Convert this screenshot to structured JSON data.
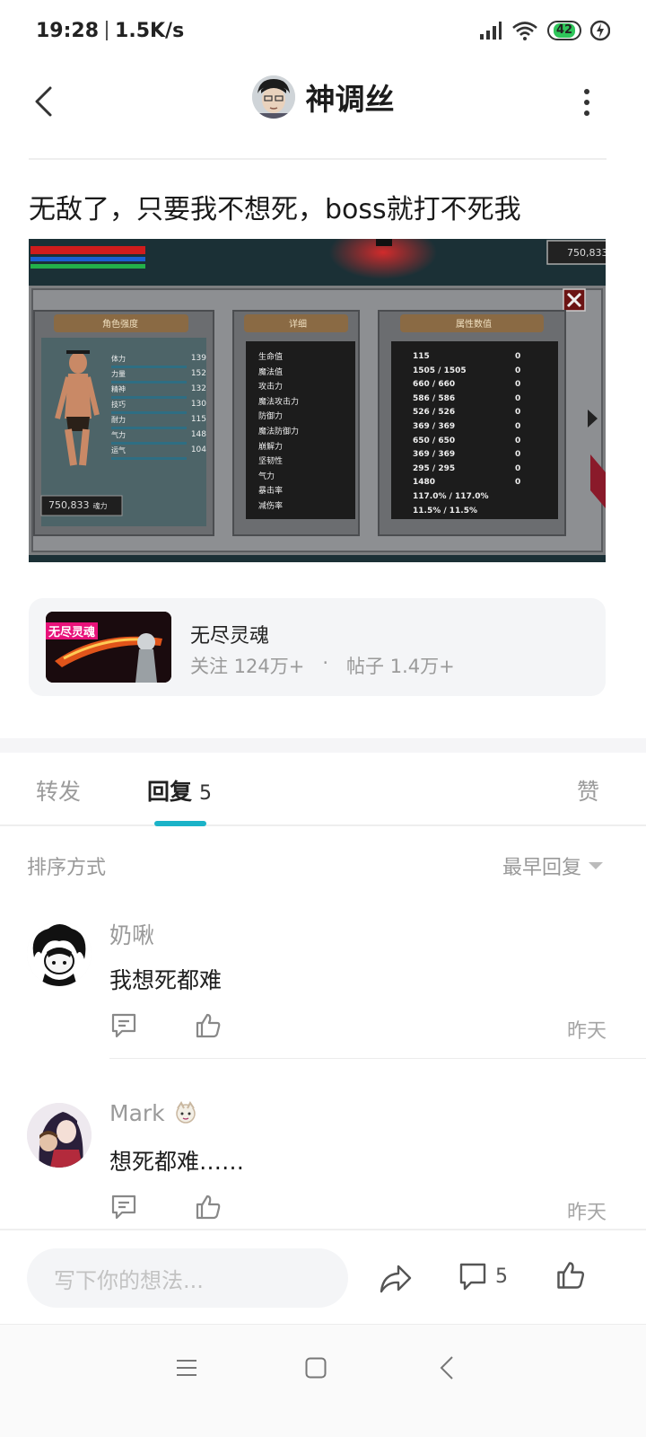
{
  "status_bar": {
    "time": "19:28",
    "net_speed": "1.5K/s",
    "battery": "42"
  },
  "header": {
    "author_name": "神调丝"
  },
  "post": {
    "title": "无敌了，只要我不想死，boss就打不死我",
    "image": {
      "currency_top": "750,833",
      "panel_character": "角色强度",
      "panel_detail": "详细",
      "panel_attributes": "属性数值",
      "char_stats": [
        {
          "label": "体力",
          "value": "139"
        },
        {
          "label": "力量",
          "value": "152"
        },
        {
          "label": "精神",
          "value": "132"
        },
        {
          "label": "技巧",
          "value": "130"
        },
        {
          "label": "耐力",
          "value": "115"
        },
        {
          "label": "气力",
          "value": "148"
        },
        {
          "label": "运气",
          "value": "104"
        }
      ],
      "currency_bottom": "750,833",
      "currency_unit": "魂力",
      "detail_items": [
        "生命值",
        "魔法值",
        "攻击力",
        "魔法攻击力",
        "防御力",
        "魔法防御力",
        "崩解力",
        "坚韧性",
        "气力",
        "暴击率",
        "减伤率"
      ],
      "attr_values": [
        "115",
        "1505 / 1505",
        "660 / 660",
        "586 / 586",
        "526 / 526",
        "369 / 369",
        "650 / 650",
        "369 / 369",
        "295 / 295",
        "1480",
        "117.0% / 117.0%",
        "11.5% / 11.5%"
      ],
      "resist_values": [
        "0",
        "0",
        "0",
        "0",
        "0",
        "0",
        "0",
        "0",
        "0",
        "0"
      ]
    }
  },
  "game_card": {
    "thumb_text": "无尽灵魂",
    "name": "无尽灵魂",
    "followers": "关注 124万+",
    "dot": "·",
    "posts": "帖子 1.4万+"
  },
  "tabs": {
    "forward": "转发",
    "reply": "回复",
    "reply_count": "5",
    "like": "赞"
  },
  "sort": {
    "label": "排序方式",
    "value": "最早回复"
  },
  "comments": [
    {
      "name": "奶啾",
      "text": "我想死都难",
      "time": "昨天"
    },
    {
      "name": "Mark",
      "text": "想死都难……",
      "time": "昨天"
    }
  ],
  "bottom_bar": {
    "placeholder": "写下你的想法...",
    "comment_count": "5"
  },
  "colors": {
    "accent": "#1bb3c8",
    "secondary_text": "#9a9a9a",
    "card_bg": "#f4f5f7"
  },
  "icons": [
    "back-arrow-icon",
    "more-icon",
    "signal-icon",
    "wifi-icon",
    "battery-icon",
    "charging-icon",
    "reply-icon",
    "thumbs-up-icon",
    "share-icon",
    "comment-icon",
    "menu-icon",
    "home-icon",
    "nav-back-icon"
  ]
}
